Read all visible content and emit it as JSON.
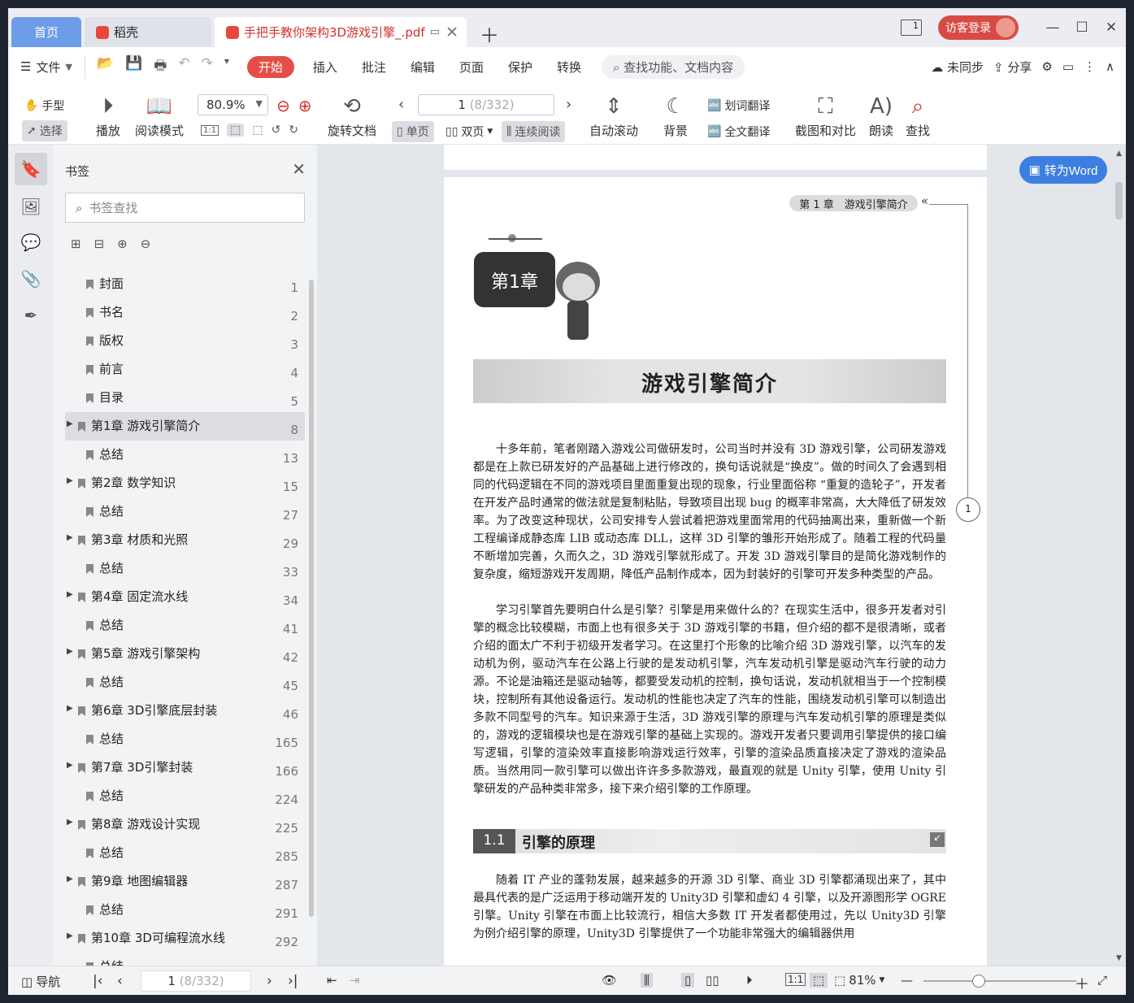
{
  "tabs": {
    "home": "首页",
    "daoke": "稻壳",
    "doc": "手把手教你架构3D游戏引擎_.pdf"
  },
  "title_bar": {
    "login_label": "访客登录",
    "page_count_icon": "1"
  },
  "menu": {
    "file": "文件",
    "items": [
      "开始",
      "插入",
      "批注",
      "编辑",
      "页面",
      "保护",
      "转换"
    ],
    "search_placeholder": "查找功能、文档内容",
    "sync": "未同步",
    "share": "分享"
  },
  "toolbar": {
    "hand": "手型",
    "select": "选择",
    "play": "播放",
    "read_mode": "阅读模式",
    "zoom": "80.9%",
    "rotate": "旋转文档",
    "page_current": "1",
    "page_total": "(8/332)",
    "single": "单页",
    "double": "双页",
    "continuous": "连续阅读",
    "autoscroll": "自动滚动",
    "background": "背景",
    "word_translate": "划词翻译",
    "full_translate": "全文翻译",
    "screenshot": "截图和对比",
    "read_aloud": "朗读",
    "find": "查找",
    "actual_size": "1:1"
  },
  "bookmarks": {
    "title": "书签",
    "search_placeholder": "书签查找",
    "items": [
      {
        "label": "封面",
        "page": "1",
        "expandable": false
      },
      {
        "label": "书名",
        "page": "2",
        "expandable": false
      },
      {
        "label": "版权",
        "page": "3",
        "expandable": false
      },
      {
        "label": "前言",
        "page": "4",
        "expandable": false
      },
      {
        "label": "目录",
        "page": "5",
        "expandable": false
      },
      {
        "label": "第1章 游戏引擎简介",
        "page": "8",
        "expandable": true,
        "selected": true
      },
      {
        "label": "总结",
        "page": "13",
        "expandable": false
      },
      {
        "label": "第2章 数学知识",
        "page": "15",
        "expandable": true
      },
      {
        "label": "总结",
        "page": "27",
        "expandable": false
      },
      {
        "label": "第3章 材质和光照",
        "page": "29",
        "expandable": true
      },
      {
        "label": "总结",
        "page": "33",
        "expandable": false
      },
      {
        "label": "第4章 固定流水线",
        "page": "34",
        "expandable": true
      },
      {
        "label": "总结",
        "page": "41",
        "expandable": false
      },
      {
        "label": "第5章 游戏引擎架构",
        "page": "42",
        "expandable": true
      },
      {
        "label": "总结",
        "page": "45",
        "expandable": false
      },
      {
        "label": "第6章 3D引擎底层封装",
        "page": "46",
        "expandable": true
      },
      {
        "label": "总结",
        "page": "165",
        "expandable": false
      },
      {
        "label": "第7章 3D引擎封装",
        "page": "166",
        "expandable": true
      },
      {
        "label": "总结",
        "page": "224",
        "expandable": false
      },
      {
        "label": "第8章 游戏设计实现",
        "page": "225",
        "expandable": true
      },
      {
        "label": "总结",
        "page": "285",
        "expandable": false
      },
      {
        "label": "第9章 地图编辑器",
        "page": "287",
        "expandable": true
      },
      {
        "label": "总结",
        "page": "291",
        "expandable": false
      },
      {
        "label": "第10章 3D可编程流水线",
        "page": "292",
        "expandable": true
      },
      {
        "label": "总结",
        "page": "",
        "expandable": false
      }
    ]
  },
  "document": {
    "running_head": "第 1 章　游戏引擎简介",
    "chapter_sign": "第1章",
    "chapter_title": "游戏引擎简介",
    "page_marker": "1",
    "paragraphs": [
      "十多年前，笔者刚踏入游戏公司做研发时，公司当时并没有 3D 游戏引擎，公司研发游戏都是在上款已研发好的产品基础上进行修改的，换句话说就是“换皮”。做的时间久了会遇到相同的代码逻辑在不同的游戏项目里面重复出现的现象，行业里面俗称 “重复的造轮子”，开发者在开发产品时通常的做法就是复制粘贴，导致项目出现 bug 的概率非常高，大大降低了研发效率。为了改变这种现状，公司安排专人尝试着把游戏里面常用的代码抽离出来，重新做一个新工程编译成静态库 LIB 或动态库 DLL，这样 3D 引擎的雏形开始形成了。随着工程的代码量不断增加完善，久而久之，3D 游戏引擎就形成了。开发 3D 游戏引擎目的是简化游戏制作的复杂度，缩短游戏开发周期，降低产品制作成本，因为封装好的引擎可开发多种类型的产品。",
      "学习引擎首先要明白什么是引擎？引擎是用来做什么的？在现实生活中，很多开发者对引擎的概念比较模糊，市面上也有很多关于 3D 游戏引擎的书籍，但介绍的都不是很清晰，或者介绍的面太广不利于初级开发者学习。在这里打个形象的比喻介绍 3D 游戏引擎，以汽车的发动机为例，驱动汽车在公路上行驶的是发动机引擎，汽车发动机引擎是驱动汽车行驶的动力源。不论是油箱还是驱动轴等，都要受发动机的控制，换句话说，发动机就相当于一个控制模块，控制所有其他设备运行。发动机的性能也决定了汽车的性能，围绕发动机引擎可以制造出多款不同型号的汽车。知识来源于生活，3D 游戏引擎的原理与汽车发动机引擎的原理是类似的，游戏的逻辑模块也是在游戏引擎的基础上实现的。游戏开发者只要调用引擎提供的接口编写逻辑，引擎的渲染效率直接影响游戏运行效率，引擎的渲染品质直接决定了游戏的渲染品质。当然用同一款引擎可以做出许许多多款游戏，最直观的就是 Unity 引擎，使用 Unity 引擎研发的产品种类非常多，接下来介绍引擎的工作原理。",
      "随着 IT 产业的蓬勃发展，越来越多的开源 3D 引擎、商业 3D 引擎都涌现出来了，其中最具代表的是广泛运用于移动端开发的 Unity3D 引擎和虚幻 4 引擎，以及开源图形学 OGRE 引擎。Unity 引擎在市面上比较流行，相信大多数 IT 开发者都使用过，先以 Unity3D 引擎为例介绍引擎的原理，Unity3D 引擎提供了一个功能非常强大的编辑器供用"
    ],
    "section_number": "1.1",
    "section_title": "引擎的原理",
    "to_word": "转为Word"
  },
  "status": {
    "nav": "导航",
    "page_current": "1",
    "page_total": "(8/332)",
    "zoom": "81%",
    "actual_size": "1:1"
  }
}
